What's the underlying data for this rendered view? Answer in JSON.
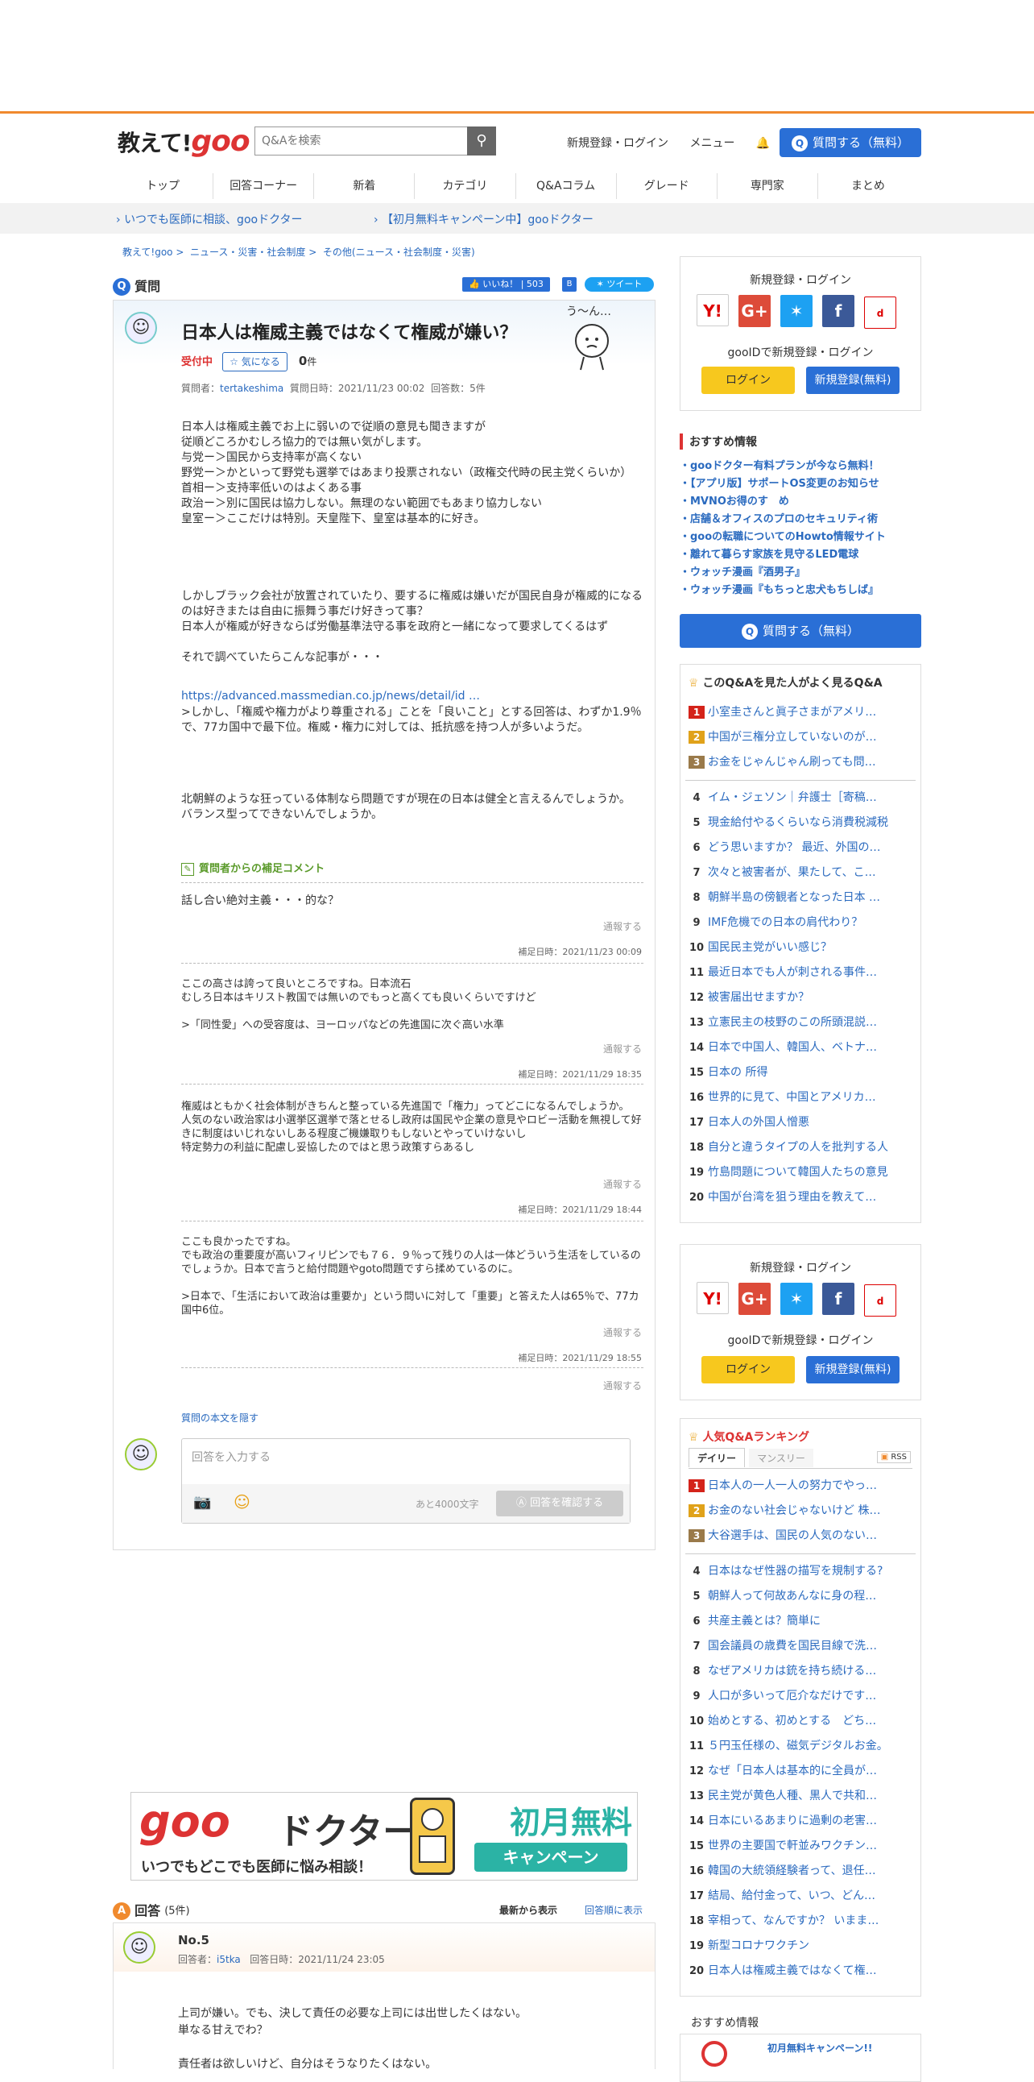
{
  "header": {
    "logo_text": "教えて!",
    "logo_goo": "goo",
    "search_placeholder": "Q&Aを検索",
    "login_link": "新規登録・ログイン",
    "menu_link": "メニュー",
    "ask_button": "質問する（無料）",
    "nav": [
      "トップ",
      "回答コーナー",
      "新着",
      "カテゴリ",
      "Q&Aコラム",
      "グレード",
      "専門家",
      "まとめ"
    ]
  },
  "promo": {
    "left": "いつでも医師に相談、gooドクター",
    "right": "【初月無料キャンペーン中】gooドクター"
  },
  "breadcrumb": [
    "教えて!goo",
    "ニュース・災害・社会制度",
    "その他(ニュース・社会制度・災害)"
  ],
  "question": {
    "section_label": "質問",
    "like_label": "いいね！",
    "like_count": "503",
    "tweet_label": "ツイート",
    "title": "日本人は権威主義ではなくて権威が嫌い？",
    "status": "受付中",
    "watch_label": "気になる",
    "watch_count": "0",
    "watch_unit": "件",
    "meta_asker_label": "質問者：",
    "meta_asker": "tertakeshima",
    "meta_date": "質問日時：2021/11/23 00:02",
    "meta_count": "回答数：5件",
    "body1": "日本人は権威主義でお上に弱いので従順の意見も聞きますが\n従順どころかむしろ協力的では無い気がします。\n与党ー＞国民から支持率が高くない\n野党ー＞かといって野党も選挙ではあまり投票されない（政権交代時の民主党くらいか）\n首相ー＞支持率低いのはよくある事\n政治ー＞別に国民は協力しない。無理のない範囲でもあまり協力しない\n皇室ー＞ここだけは特別。天皇陛下、皇室は基本的に好き。",
    "body2": "しかしブラック会社が放置されていたり、要するに権威は嫌いだが国民自身が権威的になるのは好きまたは自由に振舞う事だけ好きって事？\n日本人が権威が好きならば労働基準法守る事を政府と一緒になって要求してくるはず\n\nそれで調べていたらこんな記事が・・・",
    "link": "https://advanced.massmedian.co.jp/news/detail/id …",
    "body3": ">しかし、「権威や権力がより尊重される」ことを「良いこと」とする回答は、わずか1.9％で、77カ国中で最下位。権威・権力に対しては、抵抗感を持つ人が多いようだ。",
    "body4": "北朝鮮のような狂っている体制なら問題ですが現在の日本は健全と言えるんでしょうか。\nバランス型ってできないんでしょうか。",
    "supplement_label": "質問者からの補足コメント",
    "report_label": "通報する",
    "supplements": [
      {
        "text": "話し合い絶対主義・・・的な？",
        "date": "補足日時：2021/11/23 00:09"
      },
      {
        "text": "ここの高さは誇って良いところですね。日本流石\nむしろ日本はキリスト教国では無いのでもっと高くても良いくらいですけど\n\n>「同性愛」への受容度は、ヨーロッパなどの先進国に次ぐ高い水準",
        "date": "補足日時：2021/11/29 18:35"
      },
      {
        "text": "権威はともかく社会体制がきちんと整っている先進国で「権力」ってどこになるんでしょうか。\n人気のない政治家は小選挙区選挙で落とせるし政府は国民や企業の意見やロビー活動を無視して好きに制度はいじれないしある程度ご機嫌取りもしないとやっていけないし\n特定勢力の利益に配慮し妥協したのではと思う政策すらあるし",
        "date": "補足日時：2021/11/29 18:44"
      },
      {
        "text": "ここも良かったですね。\nでも政治の重要度が高いフィリピンでも７６．９％って残りの人は一体どういう生活をしているのでしょうか。日本で言うと給付問題やgoto問題ですら揉めているのに。\n\n>日本で、「生活において政治は重要か」という問いに対して「重要」と答えた人は65％で、77カ国中6位。",
        "date": "補足日時：2021/11/29 18:55"
      }
    ],
    "hide_body": "質問の本文を隠す",
    "answer_placeholder": "回答を入力する",
    "char_remaining": "あと4000文字",
    "confirm_button": "回答を確認する"
  },
  "sidebar": {
    "login_title": "新規登録・ログイン",
    "gooid_text": "gooIDで新規登録・ログイン",
    "login_button": "ログイン",
    "register_button": "新規登録(無料)",
    "rec_title": "おすすめ情報",
    "rec_items": [
      "・gooドクター有料プランが今なら無料！",
      "・【アプリ版】サポートOS変更のお知らせ",
      "・MVNOお得のす　め",
      "・店舗＆オフィスのプロのセキュリティ術",
      "・gooの転職についてのHowto情報サイト",
      "・離れて暮らす家族を見守るLED電球",
      "・ウォッチ漫画『酒男子』",
      "・ウォッチ漫画『もちっと忠犬もちしば』"
    ],
    "ask_button": "質問する（無料）",
    "related_title": "このQ&Aを見た人がよく見るQ&A",
    "related": [
      "小室圭さんと眞子さまがアメリ…",
      "中国が三権分立していないのが…",
      "お金をじゃんじゃん刷っても問…",
      "イム・ジェソン｜弁護士［寄稿…",
      "現金給付やるくらいなら消費税減税",
      "どう思いますか？ 最近、外国の…",
      "次々と被害者が、果たして、こ…",
      "朝鮮半島の傍観者となった日本 …",
      "IMF危機での日本の肩代わり？",
      "国民民主党がいい感じ？",
      "最近日本でも人が刺される事件…",
      "被害届出せますか？",
      "立憲民主の枝野のこの所頭混説…",
      "日本で中国人、韓国人、ベトナ…",
      "日本の 所得",
      "世界的に見て、中国とアメリカ…",
      "日本人の外国人憎悪",
      "自分と違うタイプの人を批判する人",
      "竹島問題について韓国人たちの意見",
      "中国が台湾を狙う理由を教えて…"
    ],
    "ranking_title": "人気Q&Aランキング",
    "tab_daily": "デイリー",
    "tab_monthly": "マンスリー",
    "rss": "RSS",
    "ranking": [
      "日本人の一人一人の努力でやっ…",
      "お金のない社会じゃないけど 株…",
      "大谷選手は、国民の人気のない…",
      "日本はなぜ性器の描写を規制する?",
      "朝鮮人って何故あんなに身の程…",
      "共産主義とは？簡単に",
      "国会議員の歳費を国民目線で洗…",
      "なぜアメリカは銃を持ち続ける…",
      "人口が多いって厄介なだけです…",
      "始めとする、初めとする　どち…",
      "５円玉任様の、磁気デジタルお金。",
      "なぜ「日本人は基本的に全員が…",
      "民主党が黄色人種、黒人で共和…",
      "日本にいるあまりに過剰の老害…",
      "世界の主要国で軒並みワクチン…",
      "韓国の大統領経験者って、退任…",
      "結局、給付金って、いつ、どん…",
      "宰相って、なんですか？ いまま…",
      "新型コロナワクチン",
      "日本人は権威主義ではなくて権…"
    ],
    "rec2_title": "おすすめ情報",
    "rec2_item": "初月無料キャンペーン!!"
  },
  "ad": {
    "brand_goo": "goo",
    "brand_doctor": "ドクター",
    "tagline": "いつでもどこでも医師に悩み相談！",
    "campaign": "初月無料",
    "campaign_sub": "キャンペーン"
  },
  "answers": {
    "label": "回答",
    "count": "(5件)",
    "sort_new": "最新から表示",
    "sort_order": "回答順に表示",
    "no": "No.5",
    "answerer_label": "回答者：",
    "answerer": "i5tka",
    "date": "回答日時：2021/11/24 23:05",
    "text": "上司が嫌い。でも、決して責任の必要な上司には出世したくはない。\n単なる甘えでわ？\n\n責任者は欲しいけど、自分はそうなりたくはない。"
  },
  "colors": {
    "accent": "#f08a2e",
    "brand_blue": "#2a6fd6",
    "link": "#2a6abf",
    "goo_red": "#d33"
  }
}
